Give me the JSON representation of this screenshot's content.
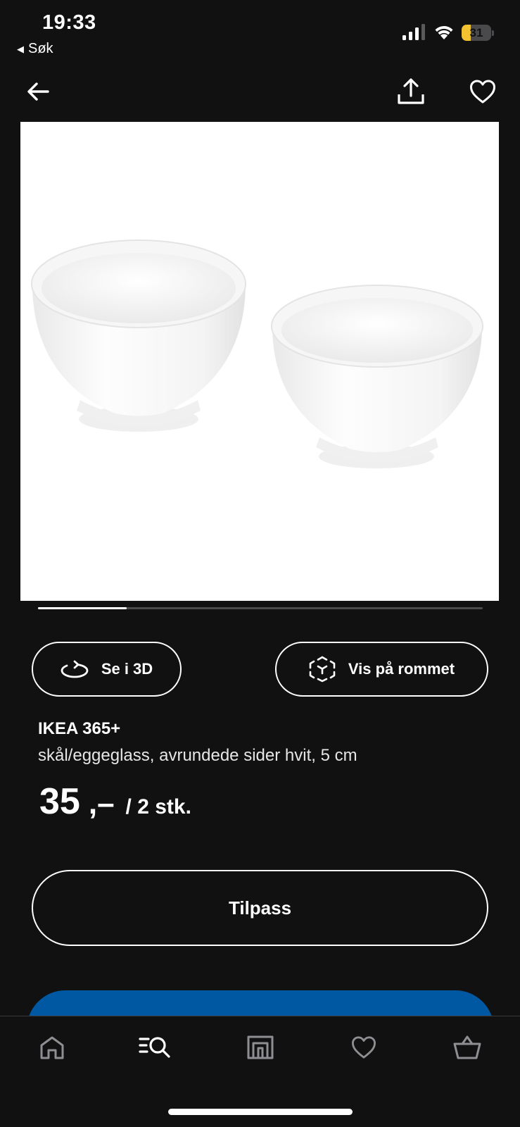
{
  "status_bar": {
    "time": "19:33",
    "back_app_label": "Søk",
    "battery_level": "31",
    "battery_fraction": 0.31
  },
  "header": {
    "back_icon": "arrow-left-icon",
    "share_icon": "share-icon",
    "favorite_icon": "heart-icon"
  },
  "gallery": {
    "image_description_icon": "product-photo",
    "progress_fraction": 0.2
  },
  "actions": {
    "view_3d_label": "Se i 3D",
    "view_3d_icon": "rotate-3d-icon",
    "view_in_room_label": "Vis på rommet",
    "view_in_room_icon": "ar-cube-icon"
  },
  "product": {
    "brand": "IKEA 365+",
    "description": "skål/eggeglass, avrundede sider hvit, 5 cm",
    "price_amount": "35",
    "price_suffix": ",–",
    "price_unit": "/ 2 stk."
  },
  "customize_label": "Tilpass",
  "colors": {
    "background": "#111112",
    "accent_blue": "#0058a3",
    "battery_yellow": "#f2c230"
  },
  "bottom_nav": {
    "items": [
      {
        "icon": "home-icon"
      },
      {
        "icon": "search-list-icon"
      },
      {
        "icon": "store-icon"
      },
      {
        "icon": "heart-icon"
      },
      {
        "icon": "basket-icon"
      }
    ]
  }
}
